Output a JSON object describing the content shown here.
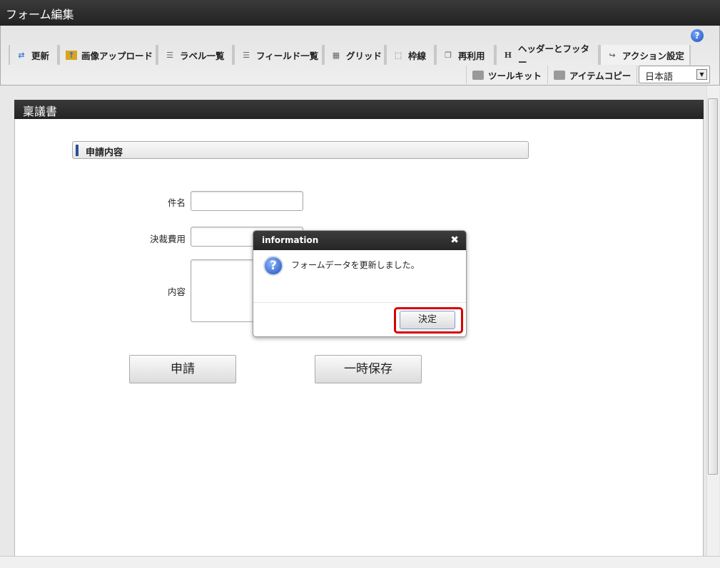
{
  "window": {
    "title": "フォーム編集"
  },
  "toolbar": {
    "help_label": "?",
    "tabs": [
      {
        "label": "更新",
        "icon": "update-icon"
      },
      {
        "label": "画像アップロード",
        "icon": "image-upload-icon"
      },
      {
        "label": "ラベル一覧",
        "icon": "list-icon"
      },
      {
        "label": "フィールド一覧",
        "icon": "list-icon"
      },
      {
        "label": "グリッド",
        "icon": "grid-icon"
      },
      {
        "label": "枠線",
        "icon": "border-icon"
      },
      {
        "label": "再利用",
        "icon": "copy-icon"
      },
      {
        "label": "ヘッダーとフッター",
        "icon": "header-icon"
      },
      {
        "label": "アクション設定",
        "icon": "action-icon"
      }
    ],
    "tabs2": [
      {
        "label": "ツールキット",
        "icon": "toolbox-icon"
      },
      {
        "label": "アイテムコピー",
        "icon": "toolbox-icon"
      }
    ],
    "language": "日本語"
  },
  "form": {
    "title": "稟議書",
    "section": "申請内容",
    "fields": [
      {
        "label": "件名",
        "value": ""
      },
      {
        "label": "決裁費用",
        "value": ""
      },
      {
        "label": "内容",
        "value": ""
      }
    ],
    "submit": "申請",
    "save": "一時保存"
  },
  "dialog": {
    "title": "information",
    "close": "✖",
    "message": "フォームデータを更新しました。",
    "ok": "決定"
  }
}
